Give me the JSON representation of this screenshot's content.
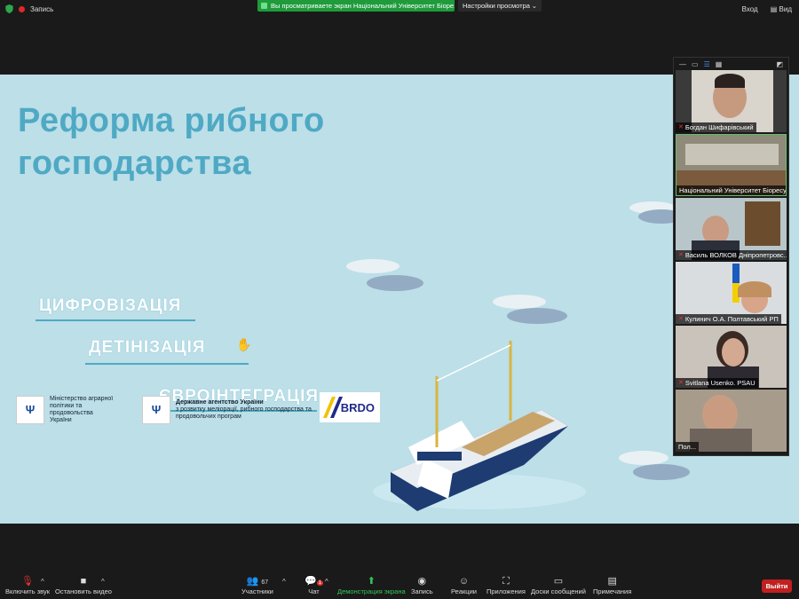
{
  "topbar": {
    "recording": "Запись",
    "share_banner": "Вы просматриваете экран Національний Університет Біоре...",
    "view_options": "Настройки просмотра",
    "login": "Вход",
    "view": "Вид"
  },
  "slide": {
    "title_line1": "Реформа рибного",
    "title_line2": "господарства",
    "kw1": "ЦИФРОВІЗАЦІЯ",
    "kw2": "ДЕТІНІЗАЦІЯ",
    "kw3": "ЄВРОІНТЕГРАЦІЯ",
    "logo1": "Міністерство аграрної політики та продовольства України",
    "logo2_title": "Державне агентство України",
    "logo2_text": "з розвитку меліорації, рибного господарства та продовольчих програм",
    "brdo": "BRDO"
  },
  "participants": [
    {
      "name": "Богдан Шифарівський"
    },
    {
      "name": "Національний Університет Біоресу..."
    },
    {
      "name": "Василь ВОЛКОВ Дніпропетровс..."
    },
    {
      "name": "Кулинич О.А. Полтавський РП"
    },
    {
      "name": "Svitlana Usenko. PSAU"
    },
    {
      "name": "Пол..."
    }
  ],
  "bottombar": {
    "unmute": "Включить звук",
    "stop_video": "Остановить видео",
    "participants": "Участники",
    "participants_count": "67",
    "chat": "Чат",
    "chat_badge": "1",
    "share": "Демонстрация экрана",
    "record": "Запись",
    "reactions": "Реакции",
    "apps": "Приложения",
    "whiteboards": "Доски сообщений",
    "notes": "Примечания",
    "leave": "Выйти"
  }
}
